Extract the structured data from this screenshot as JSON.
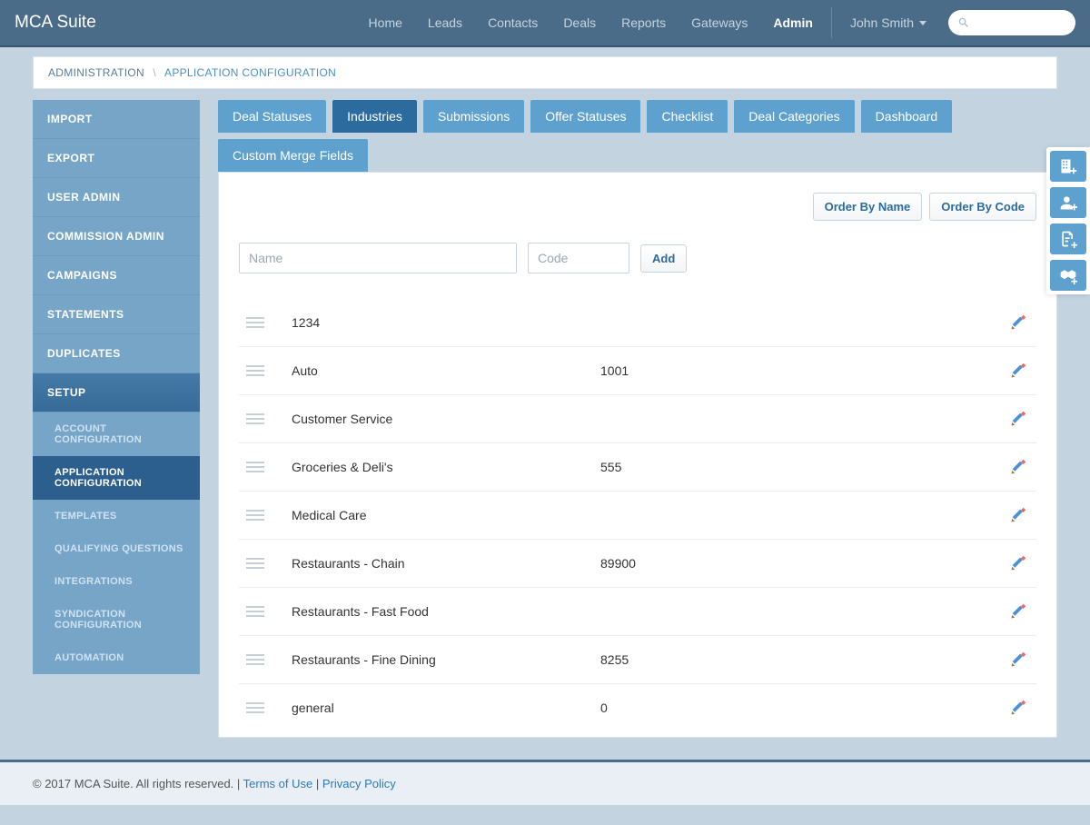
{
  "brand": "MCA Suite",
  "nav": {
    "home": "Home",
    "leads": "Leads",
    "contacts": "Contacts",
    "deals": "Deals",
    "reports": "Reports",
    "gateways": "Gateways",
    "admin": "Admin"
  },
  "user": {
    "name": "John Smith"
  },
  "breadcrumb": {
    "root": "ADMINISTRATION",
    "sep": "\\",
    "current": "APPLICATION CONFIGURATION"
  },
  "sidebar": {
    "items": [
      {
        "label": "IMPORT"
      },
      {
        "label": "EXPORT"
      },
      {
        "label": "USER ADMIN"
      },
      {
        "label": "COMMISSION ADMIN"
      },
      {
        "label": "CAMPAIGNS"
      },
      {
        "label": "STATEMENTS"
      },
      {
        "label": "DUPLICATES"
      }
    ],
    "setup": {
      "label": "SETUP",
      "children": [
        {
          "label": "ACCOUNT CONFIGURATION"
        },
        {
          "label": "APPLICATION CONFIGURATION"
        },
        {
          "label": "TEMPLATES"
        },
        {
          "label": "QUALIFYING QUESTIONS"
        },
        {
          "label": "INTEGRATIONS"
        },
        {
          "label": "SYNDICATION CONFIGURATION"
        },
        {
          "label": "AUTOMATION"
        }
      ]
    }
  },
  "tabs": [
    {
      "label": "Deal Statuses"
    },
    {
      "label": "Industries"
    },
    {
      "label": "Submissions"
    },
    {
      "label": "Offer Statuses"
    },
    {
      "label": "Checklist"
    },
    {
      "label": "Deal Categories"
    },
    {
      "label": "Dashboard"
    },
    {
      "label": "Custom Merge Fields"
    }
  ],
  "toolbar": {
    "order_by_name": "Order By Name",
    "order_by_code": "Order By Code",
    "add": "Add"
  },
  "inputs": {
    "name_placeholder": "Name",
    "code_placeholder": "Code"
  },
  "rows": [
    {
      "name": "1234",
      "code": ""
    },
    {
      "name": "Auto",
      "code": "1001"
    },
    {
      "name": "Customer Service",
      "code": ""
    },
    {
      "name": "Groceries & Deli's",
      "code": "555"
    },
    {
      "name": "Medical Care",
      "code": ""
    },
    {
      "name": "Restaurants - Chain",
      "code": "89900"
    },
    {
      "name": "Restaurants - Fast Food",
      "code": ""
    },
    {
      "name": "Restaurants - Fine Dining",
      "code": "8255"
    },
    {
      "name": "general",
      "code": "0"
    }
  ],
  "footer": {
    "copyright": "© 2017 MCA Suite. All rights reserved. | ",
    "terms": "Terms of Use",
    "sep": " | ",
    "privacy": "Privacy Policy"
  }
}
